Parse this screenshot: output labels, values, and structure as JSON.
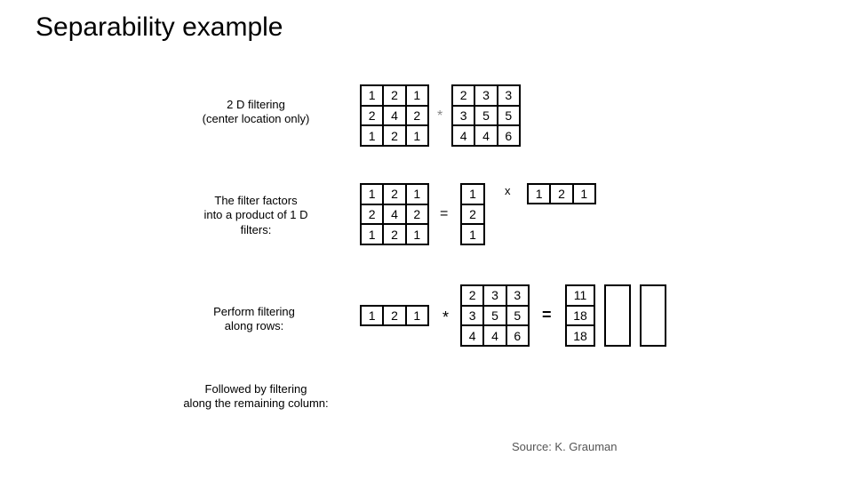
{
  "title": "Separability example",
  "captions": {
    "c1a": "2 D filtering",
    "c1b": "(center location only)",
    "c2a": "The filter factors",
    "c2b": "into a product of 1 D",
    "c2c": "filters:",
    "c3a": "Perform filtering",
    "c3b": "along rows:",
    "c4a": "Followed by filtering",
    "c4b": "along the remaining column:"
  },
  "matrices": {
    "kernel3x3": [
      "1",
      "2",
      "1",
      "2",
      "4",
      "2",
      "1",
      "2",
      "1"
    ],
    "image3x3": [
      "2",
      "3",
      "3",
      "3",
      "5",
      "5",
      "4",
      "4",
      "6"
    ],
    "col3x1": [
      "1",
      "2",
      "1"
    ],
    "row1x3": [
      "1",
      "2",
      "1"
    ],
    "result3x1": [
      "11",
      "18",
      "18"
    ]
  },
  "ops": {
    "star_small": "*",
    "eq": "=",
    "x": "x",
    "star": "*",
    "eq2": "="
  },
  "source": "Source: K. Grauman"
}
